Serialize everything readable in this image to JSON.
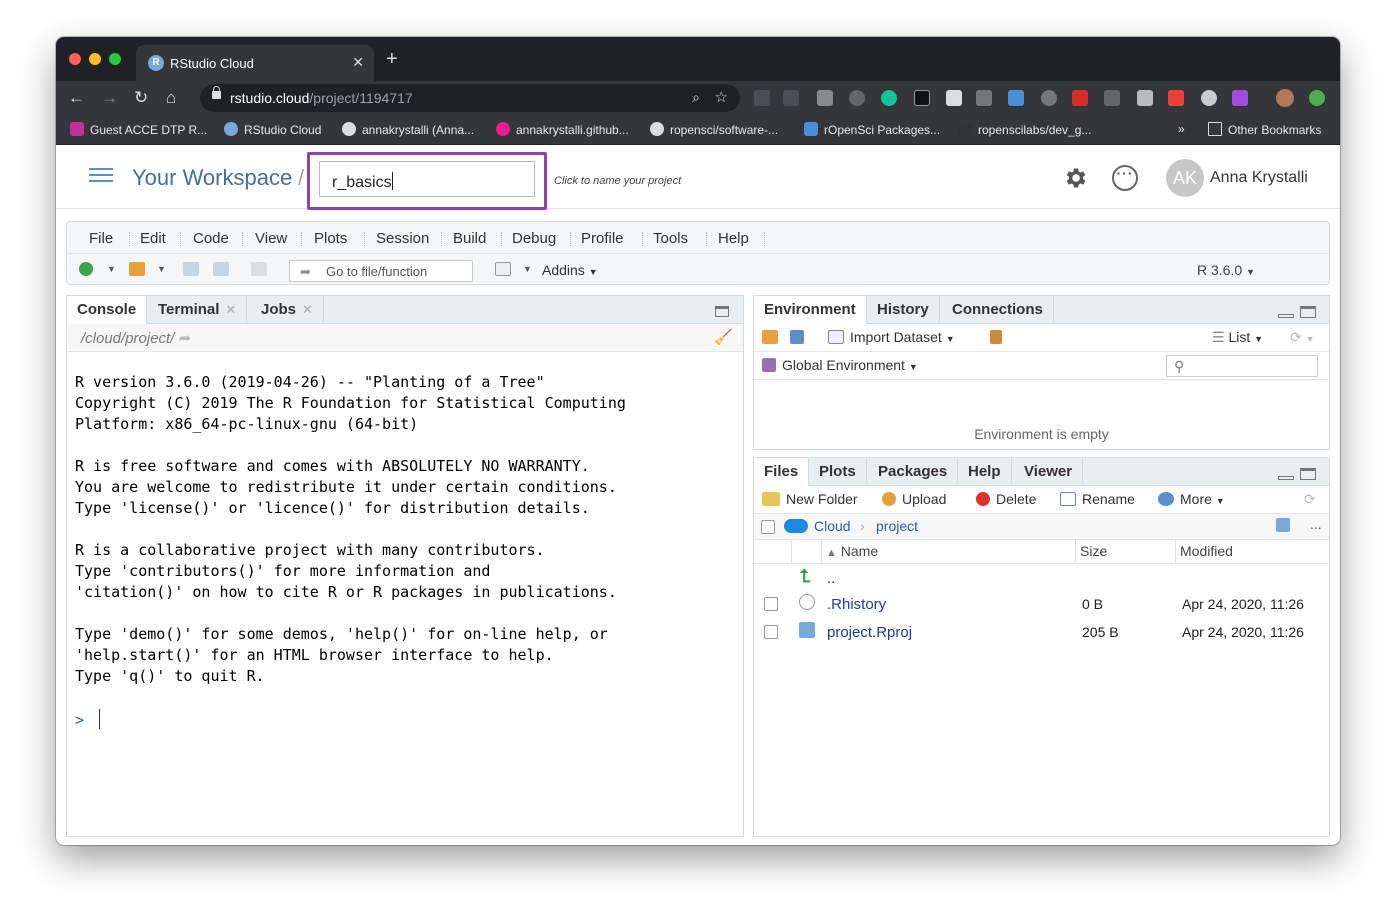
{
  "browser": {
    "tab_title": "RStudio Cloud",
    "tab_favicon": "R",
    "url_host": "rstudio.cloud",
    "url_path": "/project/1194717",
    "bookmarks": [
      "Guest ACCE DTP R...",
      "RStudio Cloud",
      "annakrystalli (Anna...",
      "annakrystalli.github...",
      "ropensci/software-...",
      "rOpenSci Packages...",
      "ropenscilabs/dev_g..."
    ],
    "overflow": "»",
    "other_bookmarks": "Other Bookmarks"
  },
  "workspace": {
    "title": "Your Workspace",
    "separator": "/",
    "project_name": "r_basics",
    "hint": "Click to name your project",
    "user_initials": "AK",
    "user_name": "Anna Krystalli"
  },
  "menu": [
    "File",
    "Edit",
    "Code",
    "View",
    "Plots",
    "Session",
    "Build",
    "Debug",
    "Profile",
    "Tools",
    "Help"
  ],
  "toolbar": {
    "goto_placeholder": "Go to file/function",
    "addins": "Addins",
    "r_version": "R 3.6.0"
  },
  "console": {
    "tabs": [
      "Console",
      "Terminal",
      "Jobs"
    ],
    "path": "/cloud/project/",
    "lines": [
      "R version 3.6.0 (2019-04-26) -- \"Planting of a Tree\"",
      "Copyright (C) 2019 The R Foundation for Statistical Computing",
      "Platform: x86_64-pc-linux-gnu (64-bit)",
      "",
      "R is free software and comes with ABSOLUTELY NO WARRANTY.",
      "You are welcome to redistribute it under certain conditions.",
      "Type 'license()' or 'licence()' for distribution details.",
      "",
      "R is a collaborative project with many contributors.",
      "Type 'contributors()' for more information and",
      "'citation()' on how to cite R or R packages in publications.",
      "",
      "Type 'demo()' for some demos, 'help()' for on-line help, or",
      "'help.start()' for an HTML browser interface to help.",
      "Type 'q()' to quit R."
    ],
    "prompt": ">"
  },
  "environment": {
    "tabs": [
      "Environment",
      "History",
      "Connections"
    ],
    "import": "Import Dataset",
    "list": "List",
    "scope": "Global Environment",
    "empty": "Environment is empty"
  },
  "files": {
    "tabs": [
      "Files",
      "Plots",
      "Packages",
      "Help",
      "Viewer"
    ],
    "actions": [
      "New Folder",
      "Upload",
      "Delete",
      "Rename",
      "More"
    ],
    "breadcrumb": [
      "Cloud",
      "project"
    ],
    "columns": [
      "Name",
      "Size",
      "Modified"
    ],
    "up": "..",
    "rows": [
      {
        "name": ".Rhistory",
        "size": "0 B",
        "modified": "Apr 24, 2020, 11:26"
      },
      {
        "name": "project.Rproj",
        "size": "205 B",
        "modified": "Apr 24, 2020, 11:26"
      }
    ],
    "more_dots": "..."
  }
}
